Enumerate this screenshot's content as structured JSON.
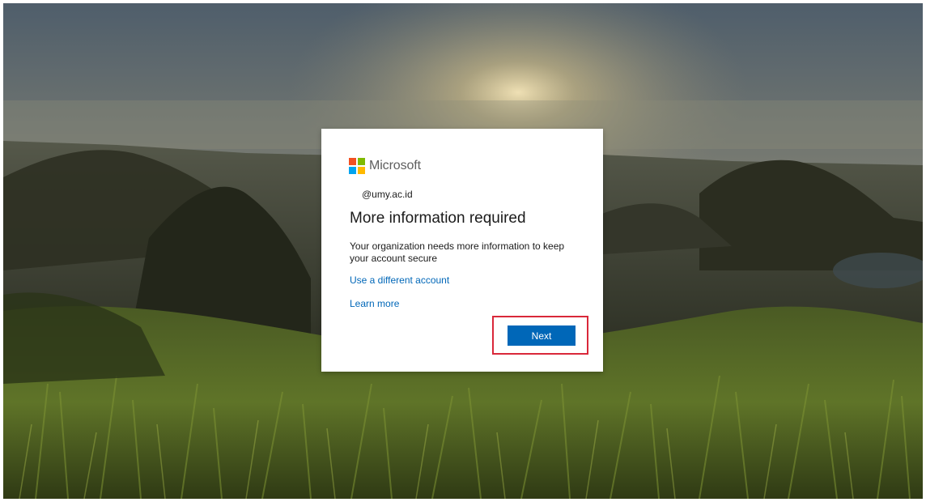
{
  "brand": {
    "name": "Microsoft",
    "logo_colors": [
      "#f25022",
      "#7fba00",
      "#00a4ef",
      "#ffb900"
    ]
  },
  "account": {
    "email": "@umy.ac.id"
  },
  "dialog": {
    "title": "More information required",
    "description": "Your organization needs more information to keep your account secure",
    "use_different_account": "Use a different account",
    "learn_more": "Learn more",
    "next_label": "Next"
  },
  "colors": {
    "accent": "#0067b8",
    "highlight_box": "#d9283a"
  },
  "icons": {
    "logo": "microsoft-logo-icon"
  }
}
